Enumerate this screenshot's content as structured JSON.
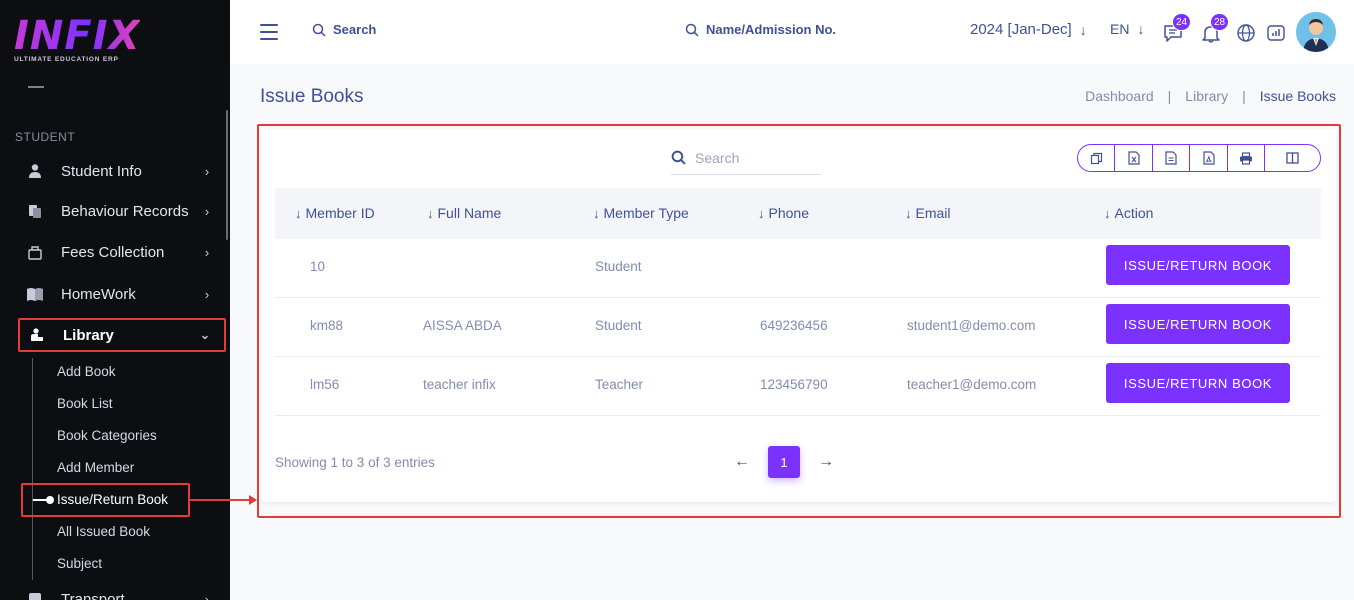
{
  "sidebar": {
    "logo_text": "INFIX",
    "logo_sub": "ULTIMATE EDUCATION ERP",
    "section_label": "STUDENT",
    "items": [
      {
        "label": "Student Info",
        "icon": "student-icon"
      },
      {
        "label": "Behaviour Records",
        "icon": "behaviour-icon"
      },
      {
        "label": "Fees Collection",
        "icon": "fees-icon"
      },
      {
        "label": "HomeWork",
        "icon": "book-open-icon"
      },
      {
        "label": "Library",
        "icon": "library-icon"
      },
      {
        "label": "Transport",
        "icon": "bus-icon"
      }
    ],
    "submenu": [
      "Add Book",
      "Book List",
      "Book Categories",
      "Add Member",
      "Issue/Return Book",
      "All Issued Book",
      "Subject"
    ]
  },
  "header": {
    "search_label": "Search",
    "admission_search_label": "Name/Admission No.",
    "session": "2024 [Jan-Dec]",
    "language": "EN",
    "messages_count": "24",
    "notifications_count": "28"
  },
  "page": {
    "title": "Issue Books",
    "breadcrumb": [
      "Dashboard",
      "Library",
      "Issue Books"
    ]
  },
  "table": {
    "search_placeholder": "Search",
    "export_buttons": [
      "copy-icon",
      "excel-icon",
      "csv-icon",
      "pdf-icon",
      "print-icon",
      "columns-icon"
    ],
    "columns": [
      "Member ID",
      "Full Name",
      "Member Type",
      "Phone",
      "Email",
      "Action"
    ],
    "rows": [
      {
        "member_id": "10",
        "full_name": "",
        "member_type": "Student",
        "phone": "",
        "email": "",
        "action": "ISSUE/RETURN BOOK"
      },
      {
        "member_id": "km88",
        "full_name": "AISSA ABDA",
        "member_type": "Student",
        "phone": "649236456",
        "email": "student1@demo.com",
        "action": "ISSUE/RETURN BOOK"
      },
      {
        "member_id": "lm56",
        "full_name": "teacher infix",
        "member_type": "Teacher",
        "phone": "123456790",
        "email": "teacher1@demo.com",
        "action": "ISSUE/RETURN BOOK"
      }
    ],
    "showing": "Showing 1 to 3 of 3 entries",
    "current_page": "1"
  },
  "colors": {
    "primary": "#7c32ff",
    "sidebar_bg": "#0d0e12",
    "highlight": "#e53a3a",
    "text_main": "#415094",
    "text_muted": "#828bb2"
  }
}
